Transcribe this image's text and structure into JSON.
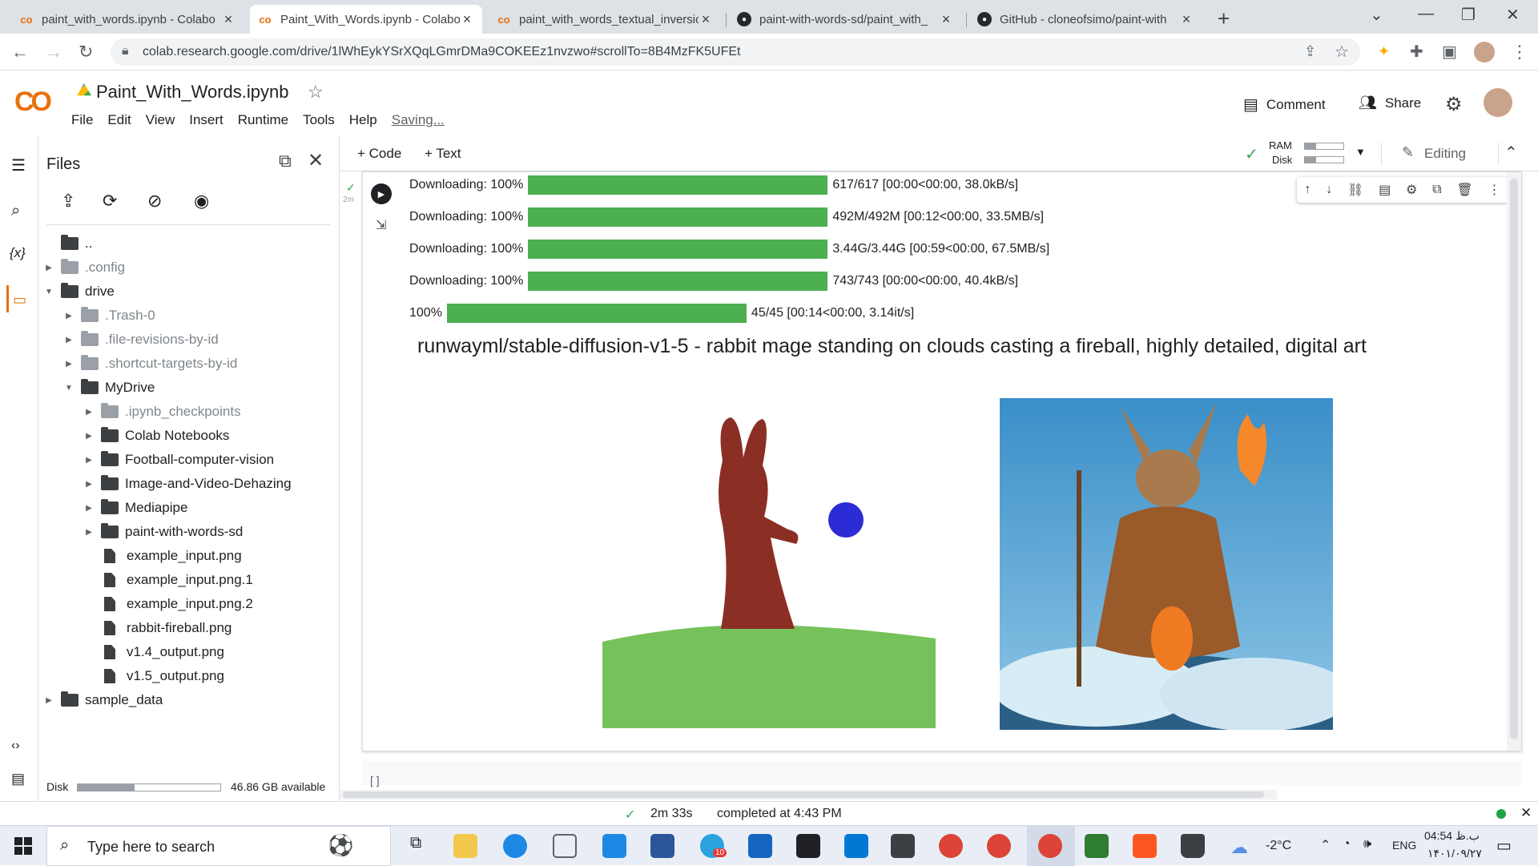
{
  "browser": {
    "tabs": [
      {
        "title": "paint_with_words.ipynb - Colabo",
        "icon": "colab-icon",
        "active": false
      },
      {
        "title": "Paint_With_Words.ipynb - Colabo",
        "icon": "colab-icon",
        "active": true
      },
      {
        "title": "paint_with_words_textual_inversio",
        "icon": "colab-icon",
        "active": false
      },
      {
        "title": "paint-with-words-sd/paint_with_",
        "icon": "github-icon",
        "active": false
      },
      {
        "title": "GitHub - cloneofsimo/paint-with",
        "icon": "github-icon",
        "active": false
      }
    ],
    "url": "colab.research.google.com/drive/1lWhEykYSrXQqLGmrDMa9COKEEz1nvzwo#scrollTo=8B4MzFK5UFEt"
  },
  "colab": {
    "logo": "CO",
    "notebook_title": "Paint_With_Words.ipynb",
    "menu": [
      "File",
      "Edit",
      "View",
      "Insert",
      "Runtime",
      "Tools",
      "Help"
    ],
    "saving": "Saving...",
    "comment_label": "Comment",
    "share_label": "Share",
    "add_code": "+ Code",
    "add_text": "+ Text",
    "ram_label": "RAM",
    "disk_label": "Disk",
    "editing_label": "Editing"
  },
  "sidebar": {
    "title": "Files",
    "tree": [
      {
        "name": "..",
        "type": "up",
        "depth": 0
      },
      {
        "name": ".config",
        "type": "folder",
        "depth": 0,
        "expanded": false
      },
      {
        "name": "drive",
        "type": "folder",
        "depth": 0,
        "expanded": true
      },
      {
        "name": ".Trash-0",
        "type": "folder",
        "depth": 1,
        "expanded": false
      },
      {
        "name": ".file-revisions-by-id",
        "type": "folder",
        "depth": 1,
        "expanded": false
      },
      {
        "name": ".shortcut-targets-by-id",
        "type": "folder",
        "depth": 1,
        "expanded": false
      },
      {
        "name": "MyDrive",
        "type": "folder",
        "depth": 1,
        "expanded": true
      },
      {
        "name": ".ipynb_checkpoints",
        "type": "folder",
        "depth": 2,
        "expanded": false
      },
      {
        "name": "Colab Notebooks",
        "type": "folder",
        "depth": 2,
        "expanded": false
      },
      {
        "name": "Football-computer-vision",
        "type": "folder",
        "depth": 2,
        "expanded": false
      },
      {
        "name": "Image-and-Video-Dehazing",
        "type": "folder",
        "depth": 2,
        "expanded": false
      },
      {
        "name": "Mediapipe",
        "type": "folder",
        "depth": 2,
        "expanded": false
      },
      {
        "name": "paint-with-words-sd",
        "type": "folder",
        "depth": 2,
        "expanded": false
      },
      {
        "name": "example_input.png",
        "type": "file",
        "depth": 2
      },
      {
        "name": "example_input.png.1",
        "type": "file",
        "depth": 2
      },
      {
        "name": "example_input.png.2",
        "type": "file",
        "depth": 2
      },
      {
        "name": "rabbit-fireball.png",
        "type": "file",
        "depth": 2
      },
      {
        "name": "v1.4_output.png",
        "type": "file",
        "depth": 2
      },
      {
        "name": "v1.5_output.png",
        "type": "file",
        "depth": 2
      },
      {
        "name": "sample_data",
        "type": "folder",
        "depth": 0,
        "expanded": false
      }
    ],
    "disk_label": "Disk",
    "disk_available": "46.86 GB available",
    "disk_used_fraction": 0.4
  },
  "cell": {
    "exec_time": "2m",
    "progress": [
      {
        "label": "Downloading: 100%",
        "stats": "617/617 [00:00<00:00, 38.0kB/s]",
        "fraction": 1.0
      },
      {
        "label": "Downloading: 100%",
        "stats": "492M/492M [00:12<00:00, 33.5MB/s]",
        "fraction": 1.0
      },
      {
        "label": "Downloading: 100%",
        "stats": "3.44G/3.44G [00:59<00:00, 67.5MB/s]",
        "fraction": 1.0
      },
      {
        "label": "Downloading: 100%",
        "stats": "743/743 [00:00<00:00, 40.4kB/s]",
        "fraction": 1.0
      },
      {
        "label": "100%",
        "stats": "45/45 [00:14<00:00, 3.14it/s]",
        "fraction": 1.0
      }
    ],
    "output_title": "runwayml/stable-diffusion-v1-5 - rabbit mage standing on clouds casting a fireball, highly detailed, digital art",
    "empty_cell": "[ ]"
  },
  "status": {
    "duration": "2m 33s",
    "completed": "completed at 4:43 PM"
  },
  "taskbar": {
    "search_placeholder": "Type here to search",
    "weather": "-2°C",
    "lang": "ENG",
    "time": "04:54 ب.ظ",
    "date": "۱۴۰۱/۰۹/۲۷",
    "telegram_badge": "10"
  }
}
